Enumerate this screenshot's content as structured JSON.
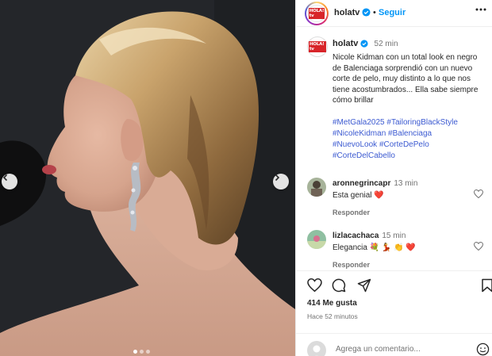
{
  "post": {
    "account": "holatv",
    "follow_label": "Seguir",
    "logo_text": "HOLA! tv",
    "caption_time": "52 min",
    "caption": "Nicole Kidman con un total look en negro de Balenciaga sorprendió con un nuevo corte de pelo, muy distinto a lo que nos tiene acostumbrados... Ella sabe siempre cómo brillar",
    "hashtags": [
      "#MetGala2025",
      "#TailoringBlackStyle",
      "#NicoleKidman",
      "#Balenciaga",
      "#NuevoLook",
      "#CorteDePelo",
      "#CorteDelCabello"
    ],
    "likes": "414 Me gusta",
    "posted_ago": "Hace 52 minutos",
    "comment_placeholder": "Agrega un comentario..."
  },
  "comments": [
    {
      "user": "aronnegrincapr",
      "time": "13 min",
      "text": "Esta genial ❤️",
      "reply_label": "Responder"
    },
    {
      "user": "lizlacachaca",
      "time": "15 min",
      "text": "Elegancia 💐 💃 👏 ❤️",
      "reply_label": "Responder"
    }
  ],
  "colors": {
    "accent": "#0095f6",
    "hashtag": "#3c5ad1",
    "heart_red": "#ed4956",
    "brand_red": "#d8252a"
  },
  "icons": [
    "chevron-left-icon",
    "chevron-right-icon",
    "more-icon",
    "verified-icon",
    "heart-icon",
    "comment-icon",
    "share-icon",
    "bookmark-icon",
    "emoji-icon"
  ]
}
